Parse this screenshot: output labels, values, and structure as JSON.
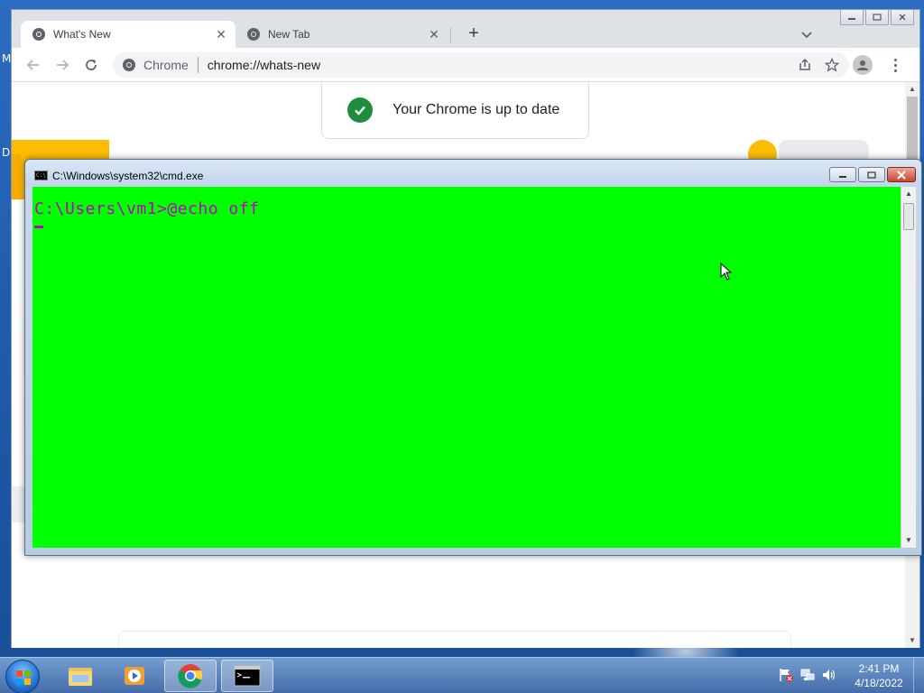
{
  "desktop": {
    "letters": [
      "M",
      "D"
    ]
  },
  "chrome": {
    "tabs": [
      {
        "title": "What's New",
        "active": true
      },
      {
        "title": "New Tab",
        "active": false
      }
    ],
    "omnibox": {
      "site_label": "Chrome",
      "url": "chrome://whats-new"
    },
    "update_message": "Your Chrome is up to date"
  },
  "cmd": {
    "title": "C:\\Windows\\system32\\cmd.exe",
    "lines": [
      "C:\\Users\\vm1>@echo off"
    ],
    "bg_color": "#00ff00",
    "text_color": "#c000c0"
  },
  "taskbar": {
    "apps": [
      "explorer-icon",
      "media-player-icon",
      "chrome-icon",
      "cmd-icon"
    ],
    "clock_time": "2:41 PM",
    "clock_date": "4/18/2022"
  }
}
